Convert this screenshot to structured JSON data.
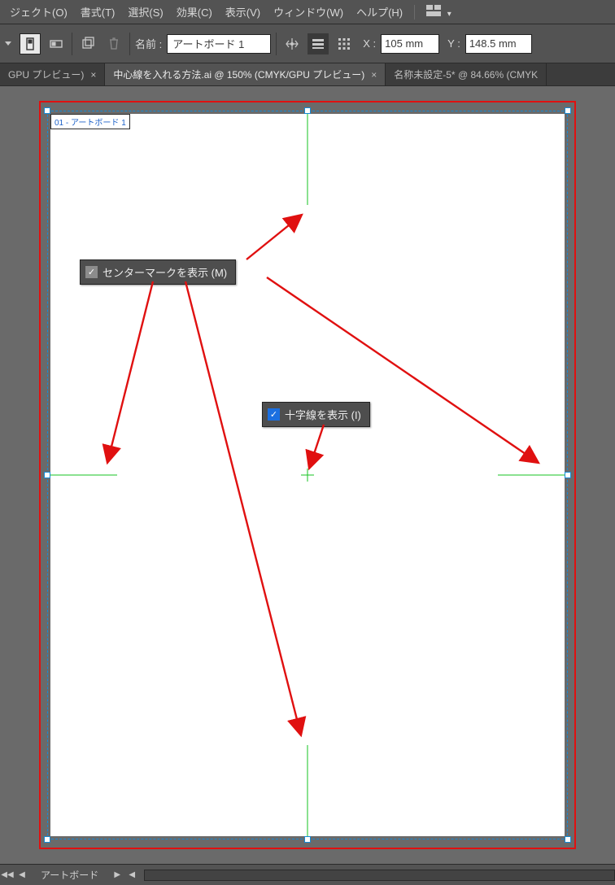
{
  "menu": {
    "items": [
      "ジェクト(O)",
      "書式(T)",
      "選択(S)",
      "効果(C)",
      "表示(V)",
      "ウィンドウ(W)",
      "ヘルプ(H)"
    ]
  },
  "controlbar": {
    "name_label": "名前 :",
    "name_value": "アートボード 1",
    "x_label": "X :",
    "x_value": "105 mm",
    "y_label": "Y :",
    "y_value": "148.5 mm"
  },
  "tabs": [
    {
      "label": "GPU プレビュー)",
      "active": false,
      "closable": true
    },
    {
      "label": "中心線を入れる方法.ai @ 150% (CMYK/GPU プレビュー)",
      "active": true,
      "closable": true
    },
    {
      "label": "名称未設定-5* @ 84.66% (CMYK",
      "active": false,
      "closable": false
    }
  ],
  "artboard": {
    "tag": "01 - アートボード 1"
  },
  "callouts": {
    "center_mark": "センターマークを表示 (M)",
    "cross_hair": "十字線を表示 (I)"
  },
  "footer": {
    "artboard_label": "アートボード"
  }
}
